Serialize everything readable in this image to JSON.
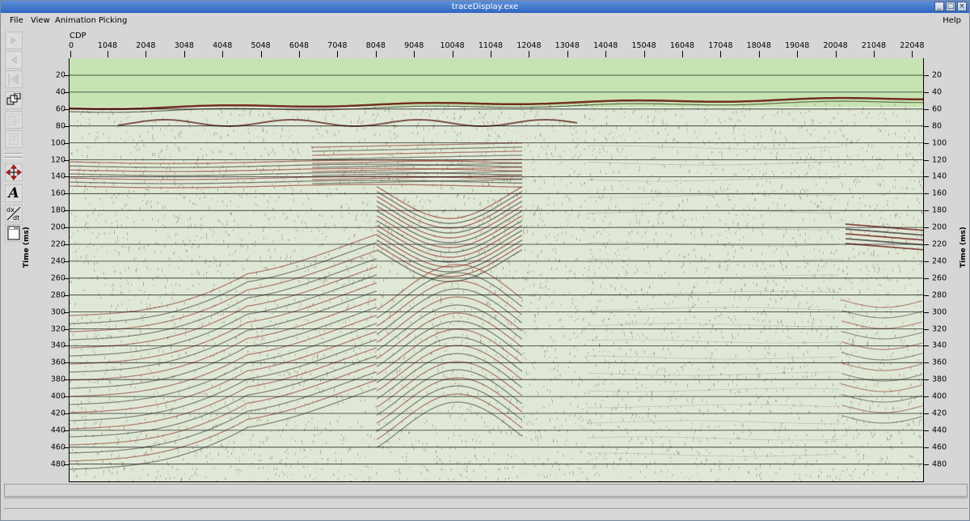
{
  "window": {
    "title": "traceDisplay.exe"
  },
  "menubar": {
    "file": "File",
    "view": "View",
    "animation": "Animation",
    "picking": "Picking",
    "help": "Help"
  },
  "toolbar": {
    "items": [
      "play-forward-icon",
      "play-back-icon",
      "step-back-icon",
      "overlay-icon",
      "copy-icon",
      "page-icon",
      "move-arrows-icon",
      "text-tool-icon",
      "derivative-icon",
      "window-icon"
    ]
  },
  "axes": {
    "x_label": "CDP",
    "x_first_tick": "0",
    "y_label": "Time (ms)",
    "x_ticks": [
      "1048",
      "2048",
      "3048",
      "4048",
      "5048",
      "6048",
      "7048",
      "8048",
      "9048",
      "10048",
      "11048",
      "12048",
      "13048",
      "14048",
      "15048",
      "16048",
      "17048",
      "18048",
      "19048",
      "20048",
      "21048",
      "22048"
    ],
    "y_ticks": [
      "20",
      "40",
      "60",
      "80",
      "100",
      "120",
      "140",
      "160",
      "180",
      "200",
      "220",
      "240",
      "260",
      "280",
      "300",
      "320",
      "340",
      "360",
      "380",
      "400",
      "420",
      "440",
      "460",
      "480"
    ]
  },
  "colors": {
    "water": "#c6e4b1",
    "background_trace": "#dfe8d6",
    "positive": "#8a2a22",
    "negative": "#3a4a40"
  }
}
